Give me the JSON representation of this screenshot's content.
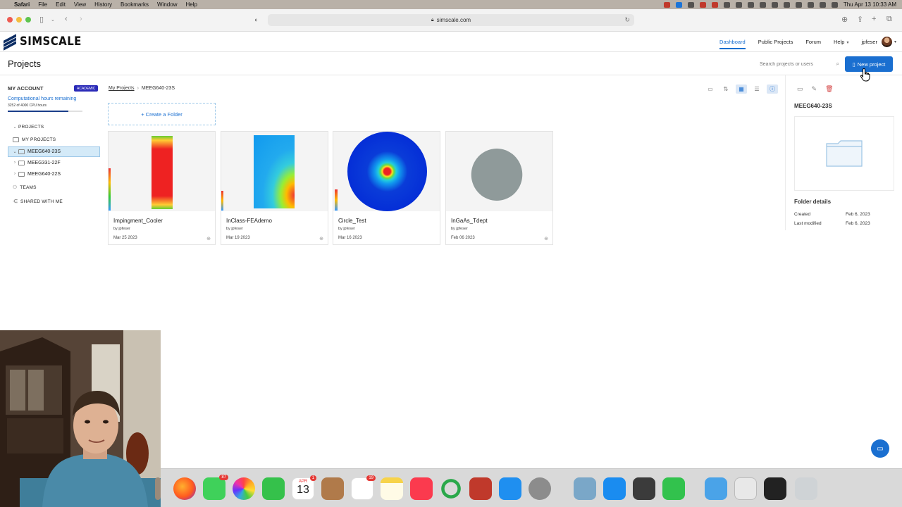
{
  "menubar": {
    "app": "Safari",
    "items": [
      "File",
      "Edit",
      "View",
      "History",
      "Bookmarks",
      "Window",
      "Help"
    ],
    "datetime": "Thu Apr 13  10:33 AM"
  },
  "browser": {
    "url": "simscale.com"
  },
  "header": {
    "logo_text": "SIMSCALE",
    "nav": [
      "Dashboard",
      "Public Projects",
      "Forum",
      "Help"
    ],
    "user": "jpfeser"
  },
  "page": {
    "title": "Projects",
    "search_placeholder": "Search projects or users",
    "new_project_label": "New project"
  },
  "sidebar": {
    "account_label": "MY ACCOUNT",
    "badge": "ACADEMIC",
    "hours_label": "Computational hours remaining",
    "hours_detail": "3252 of 4000 CPU hours",
    "hours_fraction": 0.813,
    "projects_label": "PROJECTS",
    "my_projects_label": "MY PROJECTS",
    "folders": [
      "MEEG640-23S",
      "MEEG331-22F",
      "MEEG640-22S"
    ],
    "teams_label": "TEAMS",
    "shared_label": "SHARED WITH ME"
  },
  "breadcrumb": {
    "root": "My Projects",
    "current": "MEEG640-23S"
  },
  "create_folder_label": "+ Create a Folder",
  "projects": [
    {
      "name": "Impingment_Cooler",
      "by": "by jpfeser",
      "date": "Mar 25 2023"
    },
    {
      "name": "InClass-FEAdemo",
      "by": "by jpfeser",
      "date": "Mar 19 2023"
    },
    {
      "name": "Circle_Test",
      "by": "by jpfeser",
      "date": "Mar 16 2023"
    },
    {
      "name": "InGaAs_Tdept",
      "by": "by jpfeser",
      "date": "Feb 06 2023"
    }
  ],
  "details": {
    "title": "MEEG640-23S",
    "heading": "Folder details",
    "created_label": "Created",
    "created": "Feb 6, 2023",
    "modified_label": "Last modified",
    "modified": "Feb 6, 2023"
  },
  "dock": {
    "messages_badge": "87",
    "calendar_month": "APR",
    "calendar_day": "13",
    "calendar_badge": "1",
    "reminders_badge": "19"
  },
  "colors": {
    "accent": "#1a6fd0",
    "selection": "#d4eaf8",
    "academic_badge": "#2a2ab8"
  }
}
